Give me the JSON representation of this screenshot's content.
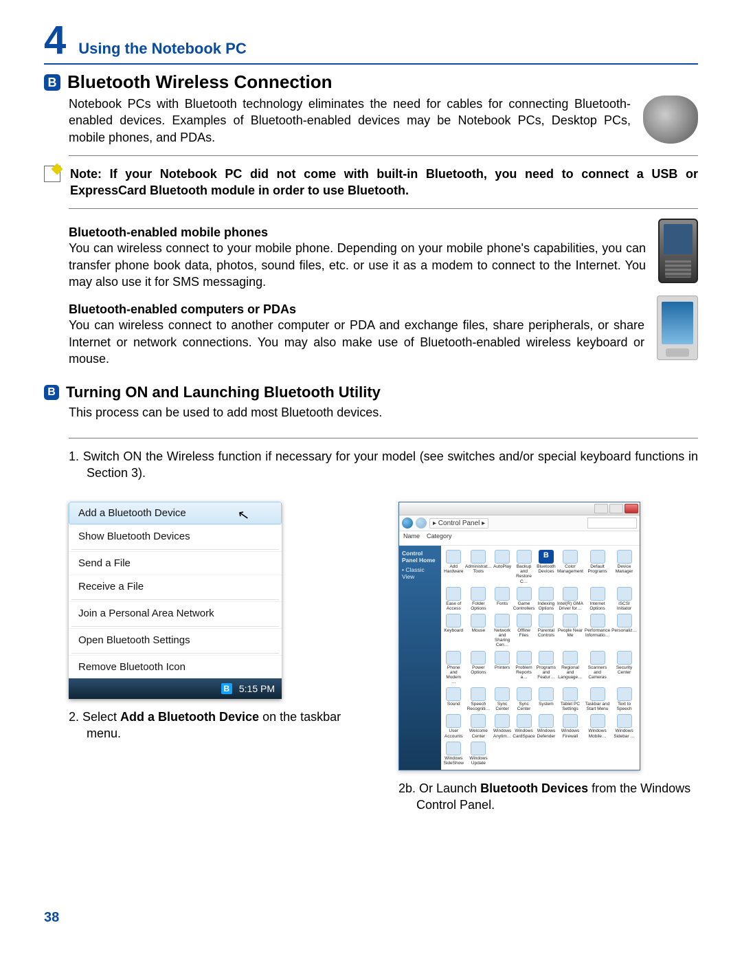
{
  "chapter": {
    "number": "4",
    "title": "Using the Notebook PC"
  },
  "section1": {
    "title": "Bluetooth Wireless Connection",
    "intro": "Notebook PCs with Bluetooth technology eliminates the need for cables for connecting Bluetooth-enabled devices. Examples of Bluetooth-enabled devices may be Notebook PCs, Desktop PCs, mobile phones, and PDAs."
  },
  "note": "Note: If your Notebook PC did not come with built-in Bluetooth, you need to connect a USB or ExpressCard Bluetooth module in order to use Bluetooth.",
  "phones": {
    "title": "Bluetooth-enabled mobile phones",
    "body": "You can wireless connect to your mobile phone. Depending on your mobile phone's capabilities, you can transfer phone book data, photos, sound files, etc. or use it as a modem to connect to the Internet. You may also use it for SMS messaging."
  },
  "pdas": {
    "title": "Bluetooth-enabled computers or PDAs",
    "body": "You can wireless connect to another computer or PDA and exchange files, share peripherals, or share Internet or network connections. You may also make use of Bluetooth-enabled wireless keyboard or mouse."
  },
  "section2": {
    "title": "Turning ON and Launching Bluetooth Utility",
    "body": "This process can be used to add most Bluetooth devices."
  },
  "step1": "1.   Switch ON the Wireless function if necessary for your model (see switches and/or special keyboard functions in Section 3).",
  "menu": {
    "items": [
      "Add a Bluetooth Device",
      "Show Bluetooth Devices",
      "Send a File",
      "Receive a File",
      "Join a Personal Area Network",
      "Open Bluetooth Settings",
      "Remove Bluetooth Icon"
    ],
    "clock": "5:15 PM"
  },
  "cpanel": {
    "breadcrumb": "▸ Control Panel ▸",
    "toolbar": {
      "name": "Name",
      "category": "Category"
    },
    "side": {
      "head": "Control Panel Home",
      "item": "• Classic View"
    },
    "icons": [
      "Add Hardware",
      "Administrat… Tools",
      "AutoPlay",
      "Backup and Restore C…",
      "Bluetooth Devices",
      "Color Management",
      "Default Programs",
      "Device Manager",
      "Ease of Access",
      "Folder Options",
      "Fonts",
      "Game Controllers",
      "Indexing Options",
      "Intel(R) GMA Driver for…",
      "Internet Options",
      "iSCSI Initiator",
      "Keyboard",
      "Mouse",
      "Network and Sharing Cen…",
      "Offline Files",
      "Parental Controls",
      "People Near Me",
      "Performance Informatio…",
      "Personaliz…",
      "Phone and Modem …",
      "Power Options",
      "Printers",
      "Problem Reports a…",
      "Programs and Featur…",
      "Regional and Language…",
      "Scanners and Cameras",
      "Security Center",
      "Sound",
      "Speech Recogniti…",
      "Sync Center",
      "Sync Center",
      "System",
      "Tablet PC Settings",
      "Taskbar and Start Menu",
      "Text to Speech",
      "User Accounts",
      "Welcome Center",
      "Windows Anytim…",
      "Windows CardSpace",
      "Windows Defender",
      "Windows Firewall",
      "Windows Mobile…",
      "Windows Sidebar …",
      "Windows SideShow",
      "Windows Update"
    ]
  },
  "caption2_pre": "2.   Select ",
  "caption2_bold": "Add a Bluetooth Device",
  "caption2_post": " on the taskbar menu.",
  "caption2b_pre": "2b. Or Launch ",
  "caption2b_bold": "Bluetooth Devices",
  "caption2b_post": " from the Windows Control Panel.",
  "page_number": "38"
}
